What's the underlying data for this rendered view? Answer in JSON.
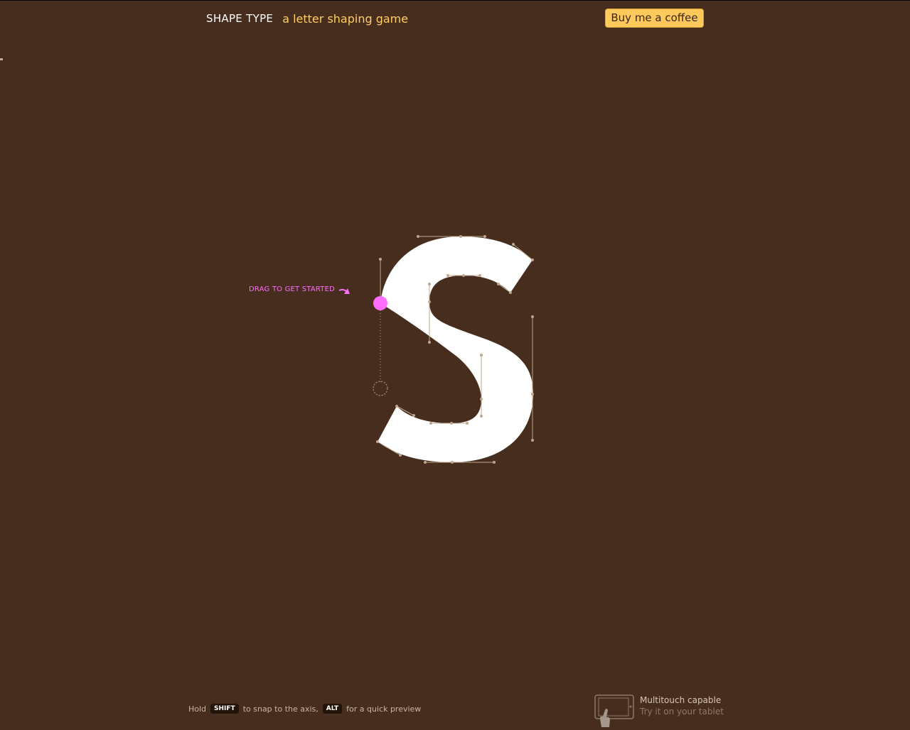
{
  "header": {
    "brand": "SHAPE TYPE",
    "tagline": "a letter shaping game",
    "coffee_button": "Buy me a coffee"
  },
  "game": {
    "hint": "DRAG TO GET STARTED",
    "letter": "S"
  },
  "footer": {
    "tip_hold": "Hold",
    "tip_key1": "SHIFT",
    "tip_mid": "to snap to the axis,",
    "tip_key2": "ALT",
    "tip_end": "for a quick preview",
    "multitouch_title": "Multitouch capable",
    "multitouch_sub": "Try it on your tablet"
  },
  "colors": {
    "background": "#472d1e",
    "accent": "#ffc95c",
    "tagline": "#ffcf66",
    "handle_active": "#ff6dff",
    "glyph": "#ffffff",
    "handle_line": "#bfa68f"
  },
  "icons": [
    "arrow-icon",
    "tablet-icon",
    "hand-icon"
  ]
}
